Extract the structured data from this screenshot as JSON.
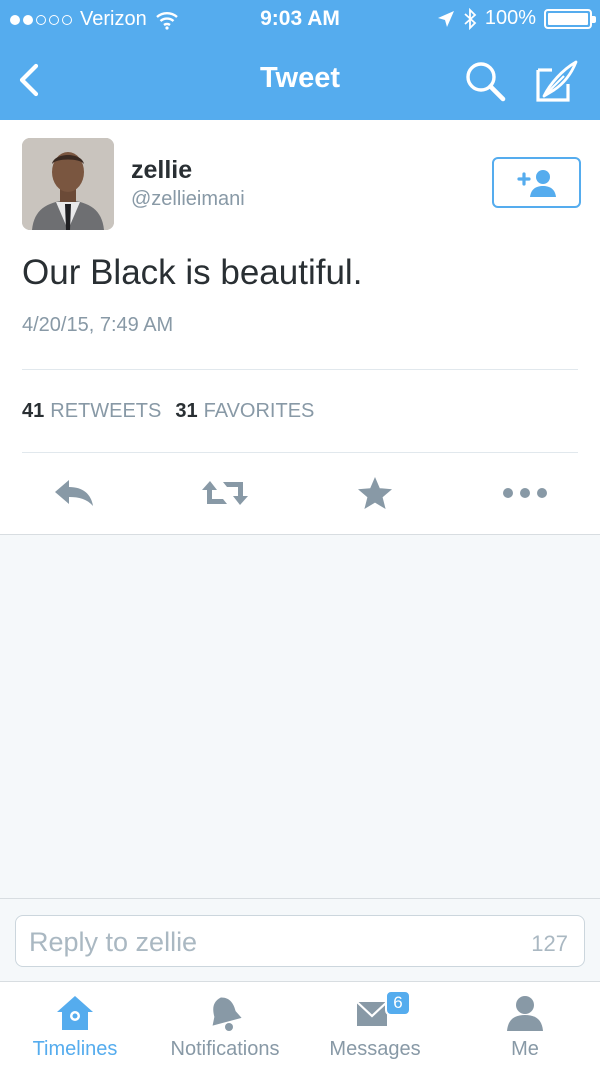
{
  "status_bar": {
    "carrier": "Verizon",
    "time": "9:03 AM",
    "battery": "100%",
    "signal_bars_filled": 2,
    "signal_bars_total": 5
  },
  "nav": {
    "title": "Tweet",
    "back_icon": "chevron-left-icon",
    "search_icon": "search-icon",
    "compose_icon": "compose-icon"
  },
  "tweet": {
    "author_name": "zellie",
    "author_handle": "@zellieimani",
    "text": "Our Black is beautiful.",
    "timestamp": "4/20/15, 7:49 AM",
    "retweets_count": "41",
    "retweets_label": "RETWEETS",
    "favorites_count": "31",
    "favorites_label": "FAVORITES"
  },
  "actions": [
    "reply-icon",
    "retweet-icon",
    "favorite-icon",
    "more-icon"
  ],
  "reply": {
    "placeholder": "Reply to zellie",
    "char_count": "127"
  },
  "tabs": [
    {
      "label": "Timelines",
      "icon": "home-icon",
      "active": true
    },
    {
      "label": "Notifications",
      "icon": "bell-icon",
      "active": false
    },
    {
      "label": "Messages",
      "icon": "envelope-icon",
      "active": false,
      "badge": "6"
    },
    {
      "label": "Me",
      "icon": "person-icon",
      "active": false
    }
  ],
  "colors": {
    "brand": "#55acee",
    "text": "#292f33",
    "muted": "#8899a6"
  }
}
